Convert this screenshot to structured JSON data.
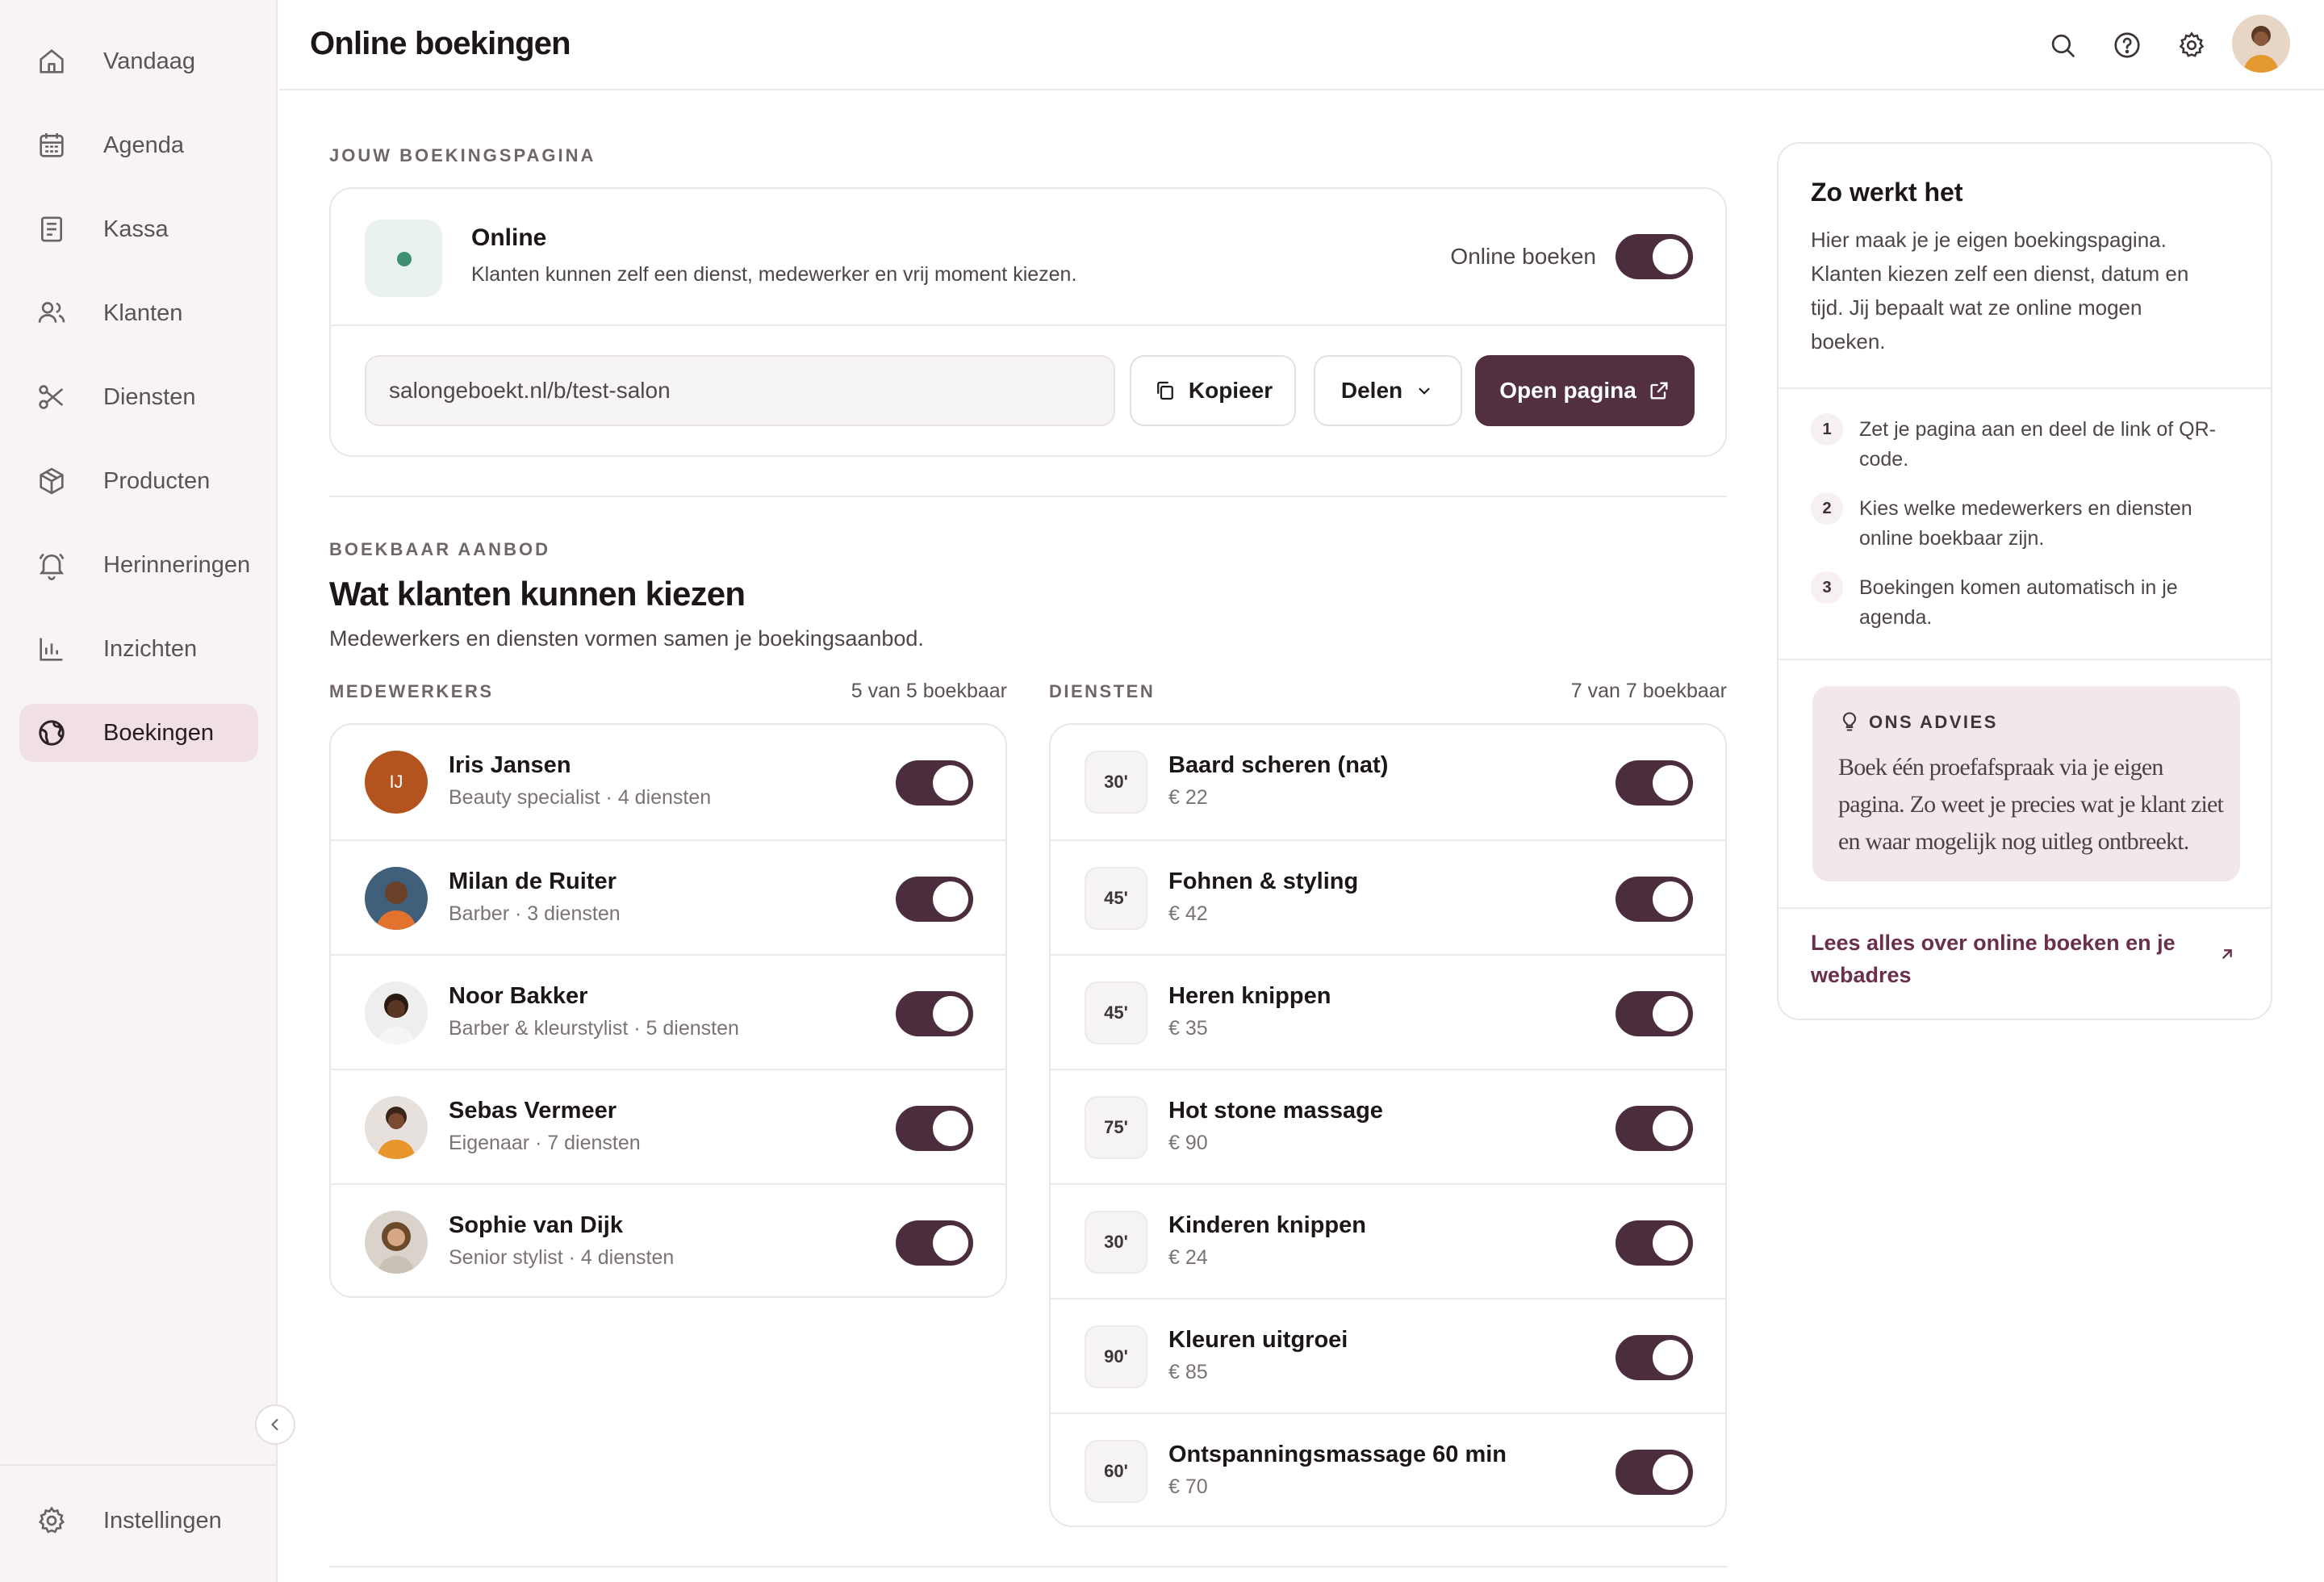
{
  "sidebar": {
    "items": [
      {
        "label": "Vandaag",
        "icon": "home-icon"
      },
      {
        "label": "Agenda",
        "icon": "calendar-icon"
      },
      {
        "label": "Kassa",
        "icon": "receipt-icon"
      },
      {
        "label": "Klanten",
        "icon": "users-icon"
      },
      {
        "label": "Diensten",
        "icon": "scissors-icon"
      },
      {
        "label": "Producten",
        "icon": "box-icon"
      },
      {
        "label": "Herinneringen",
        "icon": "bell-icon"
      },
      {
        "label": "Inzichten",
        "icon": "bar-chart-icon"
      },
      {
        "label": "Boekingen",
        "icon": "globe-icon",
        "active": true
      }
    ],
    "settings_label": "Instellingen"
  },
  "header": {
    "title": "Online boekingen"
  },
  "booking_page": {
    "kicker": "JOUW BOEKINGSPAGINA",
    "status_title": "Online",
    "status_sub": "Klanten kunnen zelf een dienst, medewerker en vrij moment kiezen.",
    "toggle_label": "Online boeken",
    "toggle_on": true,
    "url": "salongeboekt.nl/b/test-salon",
    "copy_label": "Kopieer",
    "share_label": "Delen",
    "open_label": "Open pagina"
  },
  "offer": {
    "kicker": "BOEKBAAR AANBOD",
    "title": "Wat klanten kunnen kiezen",
    "description": "Medewerkers en diensten vormen samen je boekingsaanbod.",
    "staff_head": "MEDEWERKERS",
    "staff_count": "5 van 5 boekbaar",
    "services_head": "DIENSTEN",
    "services_count": "7 van 7 boekbaar",
    "staff": [
      {
        "name": "Iris Jansen",
        "sub": "Beauty specialist · 4 diensten",
        "initials": "IJ",
        "on": true
      },
      {
        "name": "Milan de Ruiter",
        "sub": "Barber · 3 diensten",
        "on": true
      },
      {
        "name": "Noor Bakker",
        "sub": "Barber & kleurstylist · 5 diensten",
        "on": true
      },
      {
        "name": "Sebas Vermeer",
        "sub": "Eigenaar · 7 diensten",
        "on": true
      },
      {
        "name": "Sophie van Dijk",
        "sub": "Senior stylist · 4 diensten",
        "on": true
      }
    ],
    "services": [
      {
        "duration": "30'",
        "name": "Baard scheren (nat)",
        "price": "€ 22",
        "on": true
      },
      {
        "duration": "45'",
        "name": "Fohnen & styling",
        "price": "€ 42",
        "on": true
      },
      {
        "duration": "45'",
        "name": "Heren knippen",
        "price": "€ 35",
        "on": true
      },
      {
        "duration": "75'",
        "name": "Hot stone massage",
        "price": "€ 90",
        "on": true
      },
      {
        "duration": "30'",
        "name": "Kinderen knippen",
        "price": "€ 24",
        "on": true
      },
      {
        "duration": "90'",
        "name": "Kleuren uitgroei",
        "price": "€ 85",
        "on": true
      },
      {
        "duration": "60'",
        "name": "Ontspanningsmassage 60 min",
        "price": "€ 70",
        "on": true
      }
    ]
  },
  "how_it_works": {
    "title": "Zo werkt het",
    "text": "Hier maak je je eigen boekingspagina. Klanten kiezen zelf een dienst, datum en tijd. Jij bepaalt wat ze online mogen boeken.",
    "steps": [
      {
        "num": "1",
        "text": "Zet je pagina aan en deel de link of QR-code."
      },
      {
        "num": "2",
        "text": "Kies welke medewerkers en diensten online boekbaar zijn."
      },
      {
        "num": "3",
        "text": "Boekingen komen automatisch in je agenda."
      }
    ],
    "advice_kicker": "ONS ADVIES",
    "advice_text": "Boek één proefafspraak via je eigen pagina. Zo weet je precies wat je klant ziet en waar mogelijk nog uitleg ontbreekt.",
    "link_text": "Lees alles over online boeken en je webadres"
  },
  "colors": {
    "accent": "#532f42",
    "active_nav": "#f0dfe7",
    "status_green": "#3e8f6c",
    "advice_bg": "#f2e7ed"
  }
}
